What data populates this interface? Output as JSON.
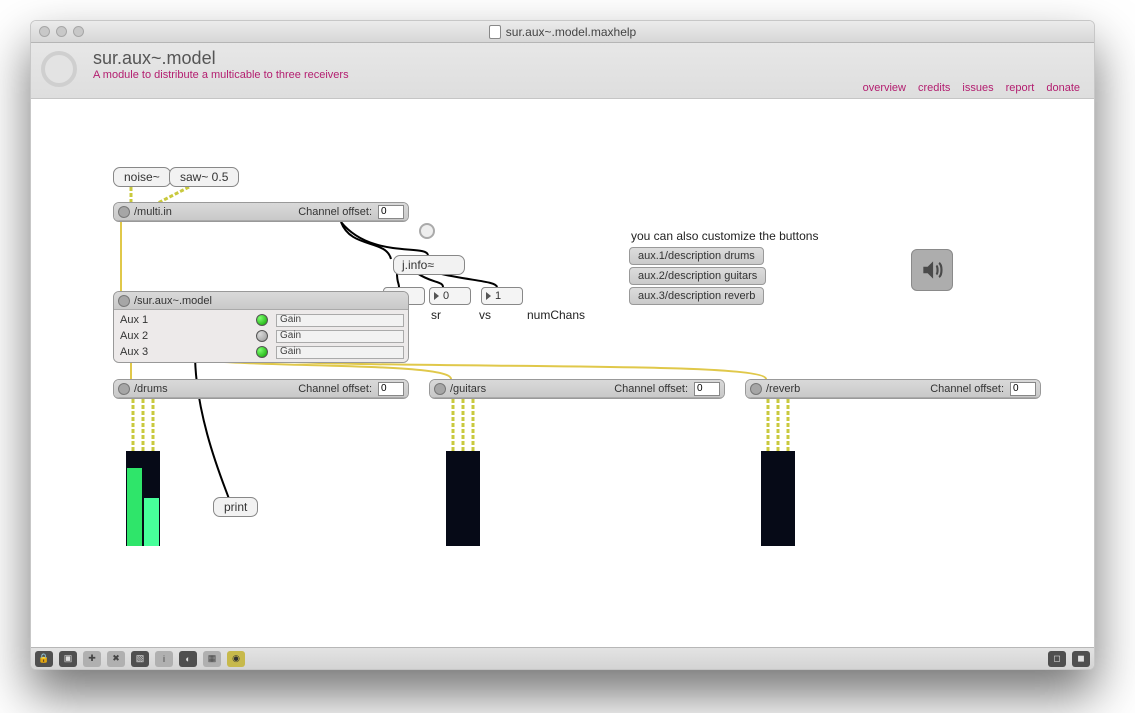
{
  "titlebar": {
    "filename": "sur.aux~.model.maxhelp"
  },
  "header": {
    "title": "sur.aux~.model",
    "subtitle": "A module to distribute a multicable to three receivers",
    "links": [
      "overview",
      "credits",
      "issues",
      "report",
      "donate"
    ]
  },
  "boxes": {
    "noise": "noise~",
    "saw": "saw~ 0.5",
    "jinfo": "j.info≈",
    "print": "print"
  },
  "info_labels": {
    "sr": "sr",
    "vs": "vs",
    "numChans": "numChans"
  },
  "info_values": {
    "sr": "0",
    "vs": "0",
    "numChans": "1"
  },
  "multi_in": {
    "name": "/multi.in",
    "offset_label": "Channel offset:",
    "offset_value": "0"
  },
  "aux_model": {
    "name": "/sur.aux~.model",
    "rows": [
      {
        "label": "Aux 1",
        "led": "green",
        "gain": "Gain"
      },
      {
        "label": "Aux 2",
        "led": "grey",
        "gain": "Gain"
      },
      {
        "label": "Aux 3",
        "led": "green",
        "gain": "Gain"
      }
    ]
  },
  "outs": [
    {
      "name": "/drums",
      "offset_label": "Channel offset:",
      "offset_value": "0"
    },
    {
      "name": "/guitars",
      "offset_label": "Channel offset:",
      "offset_value": "0"
    },
    {
      "name": "/reverb",
      "offset_label": "Channel offset:",
      "offset_value": "0"
    }
  ],
  "customize_label": "you can also customize the buttons",
  "desc_msgs": [
    "aux.1/description drums",
    "aux.2/description guitars",
    "aux.3/description reverb"
  ],
  "icons": {
    "speaker": "speaker-icon"
  },
  "toolbar_icons": [
    "lock",
    "copy",
    "axis",
    "delete",
    "pres",
    "info",
    "audio",
    "grid",
    "dsp"
  ]
}
